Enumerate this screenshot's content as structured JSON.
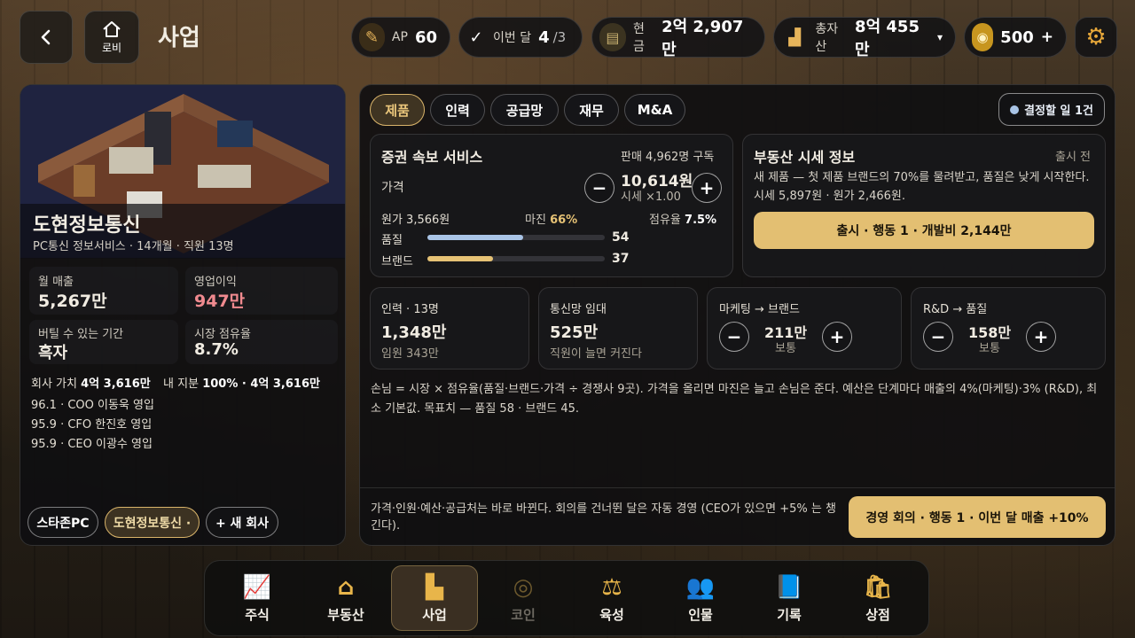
{
  "header": {
    "title": "사업",
    "back_icon": "chevron-left-icon",
    "lobby_label": "로비"
  },
  "stats": {
    "ap": {
      "label": "AP",
      "value": "60"
    },
    "month": {
      "label": "이번 달",
      "value": "4",
      "total": "/3"
    },
    "cash": {
      "label": "현금",
      "value": "2억 2,907만"
    },
    "assets": {
      "label": "총자산",
      "value": "8억 455만",
      "caret": "▾"
    },
    "coins": {
      "value": "500",
      "plus": "+"
    }
  },
  "company": {
    "name": "도현정보통신",
    "subtitle": "PC통신 정보서비스 · 14개월 · 직원 13명",
    "monthly_sales_label": "월 매출",
    "monthly_sales": "5,267만",
    "op_profit_label": "영업이익",
    "op_profit": "947만",
    "runway_label": "버틸 수 있는 기간",
    "runway": "흑자",
    "share_label": "시장 점유율",
    "share": "8.7%",
    "value_label": "회사 가치",
    "value": "4억 3,616만",
    "equity_label": "내 지분",
    "equity": "100% · 4억 3,616만",
    "execs": [
      "96.1 · COO 이동욱 영입",
      "95.9 · CFO 한진호 영입",
      "95.9 · CEO 이광수 영입"
    ],
    "chips": [
      "스타존PC",
      "도현정보통신 ·",
      "+ 새 회사"
    ]
  },
  "tabs": [
    "제품",
    "인력",
    "공급망",
    "재무",
    "M&A"
  ],
  "decision_badge": "결정할 일 1건",
  "product": {
    "name": "증권 속보 서비스",
    "sales": "판매 4,962명 구독",
    "price_label": "가격",
    "price": "10,614원",
    "market_price": "시세 ×1.00",
    "cost": "원가 3,566원",
    "margin_label": "마진",
    "margin": "66%",
    "share_label": "점유율",
    "share": "7.5%",
    "quality_label": "품질",
    "quality": "54",
    "brand_label": "브랜드",
    "brand": "37"
  },
  "realty": {
    "title": "부동산 시세 정보",
    "status": "출시 전",
    "desc": "새 제품 — 첫 제품 브랜드의 70%를 물려받고, 품질은 낮게 시작한다. 시세 5,897원 · 원가 2,466원.",
    "launch_button": "출시 · 행동 1 · 개발비 2,144만"
  },
  "staff": {
    "title": "인력 · 13명",
    "value": "1,348만",
    "sub": "임원 343만"
  },
  "network": {
    "title": "통신망 임대",
    "value": "525만",
    "sub": "직원이 늘면 커진다"
  },
  "marketing": {
    "title": "마케팅 → 브랜드",
    "value": "211만",
    "sub": "보통"
  },
  "rnd": {
    "title": "R&D → 품질",
    "value": "158만",
    "sub": "보통"
  },
  "formula": "손님 = 시장 × 점유율(품질·브랜드·가격 ÷ 경쟁사 9곳). 가격을 올리면 마진은 늘고 손님은 준다. 예산은 단계마다 매출의 4%(마케팅)·3% (R&D), 최소 기본값. 목표치 — 품질 58 · 브랜드 45.",
  "footer_note": "가격·인원·예산·공급처는 바로 바뀐다. 회의를 건너뛴 달은 자동 경영 (CEO가 있으면 +5% 는 챙긴다).",
  "meeting_button": "경영 회의 · 행동 1 · 이번 달 매출 +10%",
  "nav": [
    "주식",
    "부동산",
    "사업",
    "코인",
    "육성",
    "인물",
    "기록",
    "상점"
  ],
  "colors": {
    "accent": "#e6c275",
    "profit": "#f08a8f",
    "quality_bar": "#a9c4e6",
    "brand_bar": "#e6c275"
  }
}
